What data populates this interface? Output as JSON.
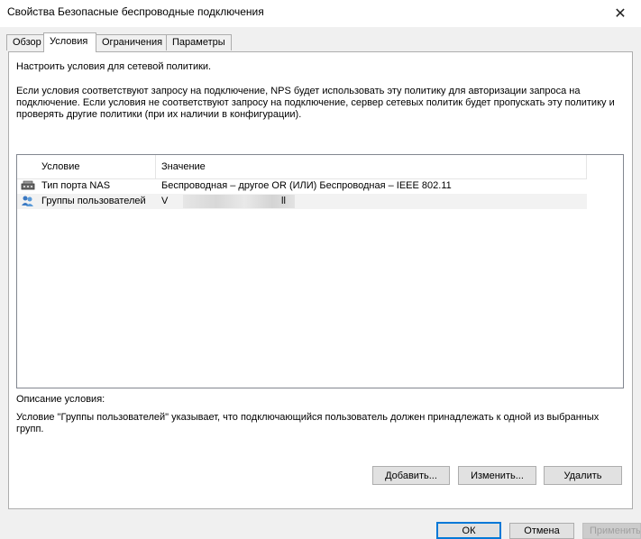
{
  "window": {
    "title": "Свойства Безопасные беспроводные подключения",
    "close_glyph": "✕"
  },
  "tabs": [
    {
      "label": "Обзор"
    },
    {
      "label": "Условия"
    },
    {
      "label": "Ограничения"
    },
    {
      "label": "Параметры"
    }
  ],
  "active_tab": "Условия",
  "conditions": {
    "heading": "Настроить условия для сетевой политики.",
    "info_line1": "Если условия соответствуют запросу на подключение, NPS будет использовать эту политику для авторизации запроса на",
    "info_line2": "подключение. Если условия не соответствуют запросу на подключение, сервер сетевых политик будет пропускать эту политику и",
    "info_line3": "проверять другие политики (при их наличии в конфигурации).",
    "columns": {
      "condition": "Условие",
      "value": "Значение"
    },
    "rows": [
      {
        "icon": "network-port-icon",
        "condition": "Тип порта NAS",
        "value": "Беспроводная – другое OR (ИЛИ) Беспроводная – IEEE 802.11"
      },
      {
        "icon": "user-group-icon",
        "condition": "Группы пользователей",
        "value_prefix": "V",
        "value_suffix": "ll"
      }
    ],
    "description_label": "Описание условия:",
    "description_line1": "Условие \"Группы пользователей\" указывает, что подключающийся пользователь должен принадлежать к одной из выбранных",
    "description_line2": "групп.",
    "buttons": {
      "add": "Добавить...",
      "edit": "Изменить...",
      "remove": "Удалить"
    }
  },
  "dialog_buttons": {
    "ok": "ОК",
    "cancel": "Отмена",
    "apply": "Применить"
  },
  "colors": {
    "accent": "#0078d7",
    "border": "#adadad"
  }
}
